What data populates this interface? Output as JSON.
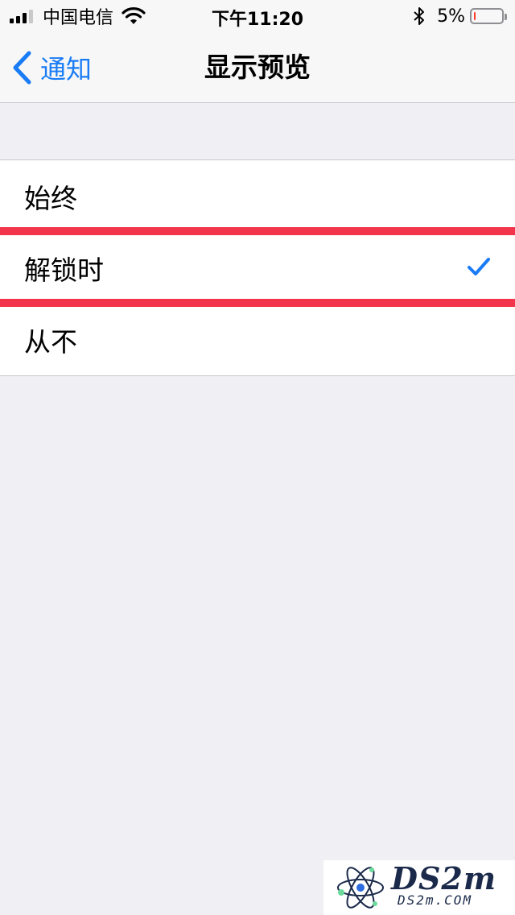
{
  "status_bar": {
    "carrier": "中国电信",
    "time": "下午11:20",
    "battery_percent": "5%",
    "battery_level": 0.05,
    "battery_color": "#ff3b30",
    "signal_bars_filled": 3,
    "signal_bars_total": 4,
    "icons": [
      "signal-icon",
      "wifi-icon",
      "bluetooth-icon",
      "battery-icon"
    ]
  },
  "nav": {
    "back_label": "通知",
    "title": "显示预览",
    "accent_color": "#1a7cf5"
  },
  "options": [
    {
      "label": "始终",
      "selected": false
    },
    {
      "label": "解锁时",
      "selected": true
    },
    {
      "label": "从不",
      "selected": false
    }
  ],
  "highlight_color": "#f2354a",
  "watermark": {
    "main": "DS2m",
    "sub": "DS2m.COM"
  }
}
